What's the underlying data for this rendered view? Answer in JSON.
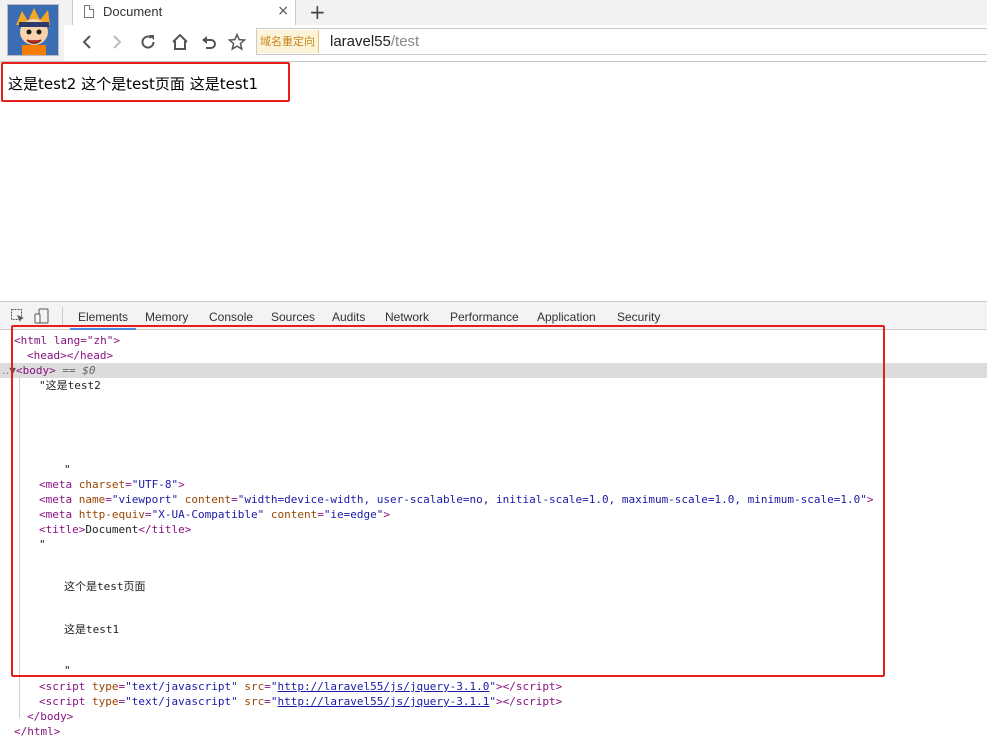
{
  "browser": {
    "tab_title": "Document",
    "tab_close": "×",
    "new_tab": "+",
    "redirect_badge": "域名重定向",
    "url_host": "laravel55",
    "url_path": "/test"
  },
  "page": {
    "text": "这是test2 这个是test页面 这是test1"
  },
  "devtools": {
    "tabs": [
      "Elements",
      "Memory",
      "Console",
      "Sources",
      "Audits",
      "Network",
      "Performance",
      "Application",
      "Security"
    ],
    "dom": {
      "html_open": "<html lang=\"zh\">",
      "head": "<head></head>",
      "body_open": "<body>",
      "body_eq": "== $0",
      "text1": "\"这是test2",
      "quote1": "\"",
      "meta1_name": "charset",
      "meta1_val": "\"UTF-8\"",
      "meta2_attr1": "name",
      "meta2_val1": "\"viewport\"",
      "meta2_attr2": "content",
      "meta2_val2": "\"width=device-width, user-scalable=no, initial-scale=1.0, maximum-scale=1.0, minimum-scale=1.0\"",
      "meta3_attr1": "http-equiv",
      "meta3_val1": "\"X-UA-Compatible\"",
      "meta3_attr2": "content",
      "meta3_val2": "\"ie=edge\"",
      "title_text": "Document",
      "quote2": "\"",
      "text2": "这个是test页面",
      "text3": "这是test1",
      "quote3": "\"",
      "script_type": "\"text/javascript\"",
      "script1_src": "http://laravel55/js/jquery-3.1.0",
      "script2_src": "http://laravel55/js/jquery-3.1.1",
      "body_close": "</body>",
      "html_close": "</html>"
    }
  },
  "colors": {
    "highlight": "#e4201c",
    "tag": "#881280",
    "attr": "#994500",
    "value": "#1a1aa6",
    "active_tab": "#4a88e8"
  }
}
